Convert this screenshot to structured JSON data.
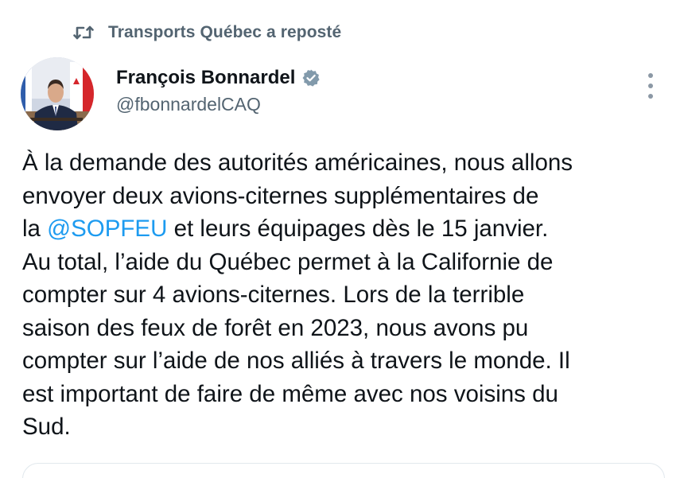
{
  "repost": {
    "icon": "repost-icon",
    "text": "Transports Québec a reposté"
  },
  "author": {
    "name": "François Bonnardel",
    "handle": "@fbonnardelCAQ",
    "verified_icon": "verified-badge-icon"
  },
  "more_icon": "more-vertical-icon",
  "tweet": {
    "line1": "À la demande des autorités américaines, nous allons",
    "line2": "envoyer deux avions-citernes supplémentaires de",
    "line3_before": "la ",
    "line3_mention": "@SOPFEU",
    "line3_after": " et leurs équipages dès le 15 janvier.",
    "line4": "Au total, l’aide du Québec permet à la Californie de",
    "line5": "compter sur 4 avions-citernes. Lors de la terrible",
    "line6": "saison des feux de forêt en 2023, nous avons pu",
    "line7": "compter sur l’aide de nos alliés à travers le monde. Il",
    "line8": "est important de faire de même avec nos voisins du",
    "line9": "Sud."
  },
  "colors": {
    "text": "#0f1419",
    "secondary": "#536471",
    "link": "#1d9bf0",
    "verified": "#829aab"
  }
}
